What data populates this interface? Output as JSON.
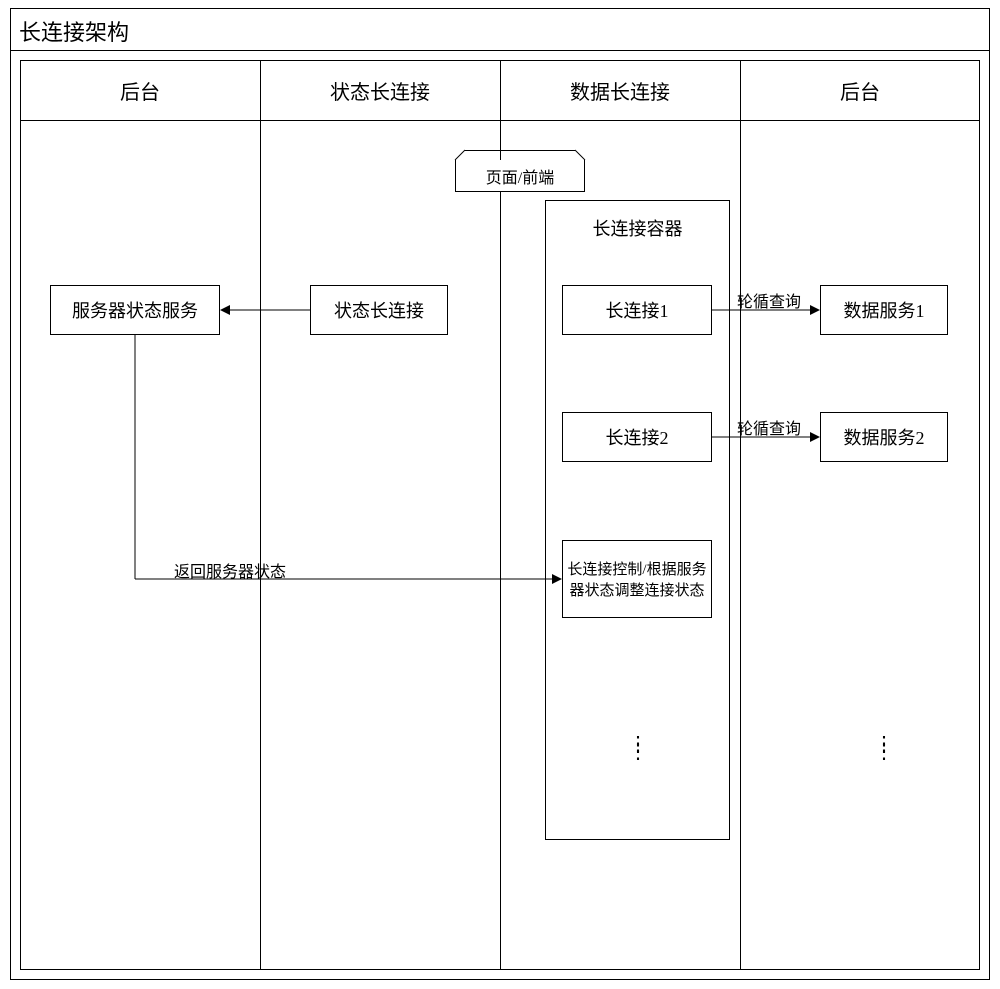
{
  "title": "长连接架构",
  "columns": {
    "backend_left": "后台",
    "state_conn": "状态长连接",
    "data_conn": "数据长连接",
    "backend_right": "后台"
  },
  "tab": {
    "label": "页面/前端"
  },
  "nodes": {
    "server_state_service": "服务器状态服务",
    "state_long_conn": "状态长连接",
    "container_title": "长连接容器",
    "long_conn_1": "长连接1",
    "long_conn_2": "长连接2",
    "controller": "长连接控制/根据服务器状态调整连接状态",
    "data_service_1": "数据服务1",
    "data_service_2": "数据服务2"
  },
  "edges": {
    "poll_query_1": "轮循查询",
    "poll_query_2": "轮循查询",
    "return_state": "返回服务器状态"
  }
}
